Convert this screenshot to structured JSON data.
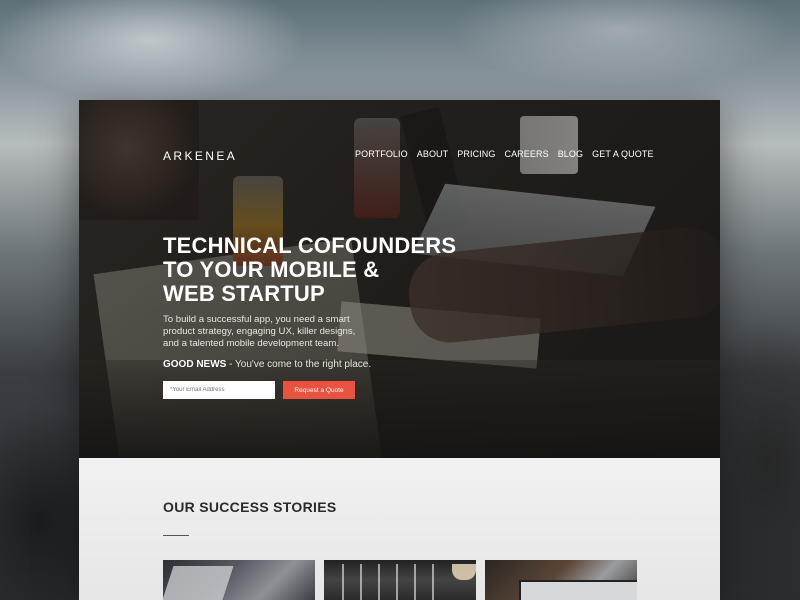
{
  "brand": {
    "logo": "ARKENEA"
  },
  "nav": {
    "items": [
      {
        "label": "PORTFOLIO"
      },
      {
        "label": "ABOUT"
      },
      {
        "label": "PRICING"
      },
      {
        "label": "CAREERS"
      },
      {
        "label": "BLOG"
      },
      {
        "label": "GET A QUOTE"
      }
    ]
  },
  "hero": {
    "headline": [
      "TECHNICAL COFOUNDERS",
      "TO YOUR MOBILE &",
      "WEB STARTUP"
    ],
    "subtext": [
      "To build a successful app, you need a smart",
      "product strategy, engaging UX, killer designs,",
      "and a talented mobile development team."
    ],
    "good_news_label": "GOOD NEWS",
    "good_news_text": " - You've come to the right place.",
    "email_placeholder": "*Your Email Address",
    "cta_label": "Request a Quote"
  },
  "success": {
    "title": "OUR SUCCESS STORIES"
  },
  "colors": {
    "accent": "#e8533f",
    "section_bg": "#efefef",
    "title": "#2b2b2b"
  }
}
